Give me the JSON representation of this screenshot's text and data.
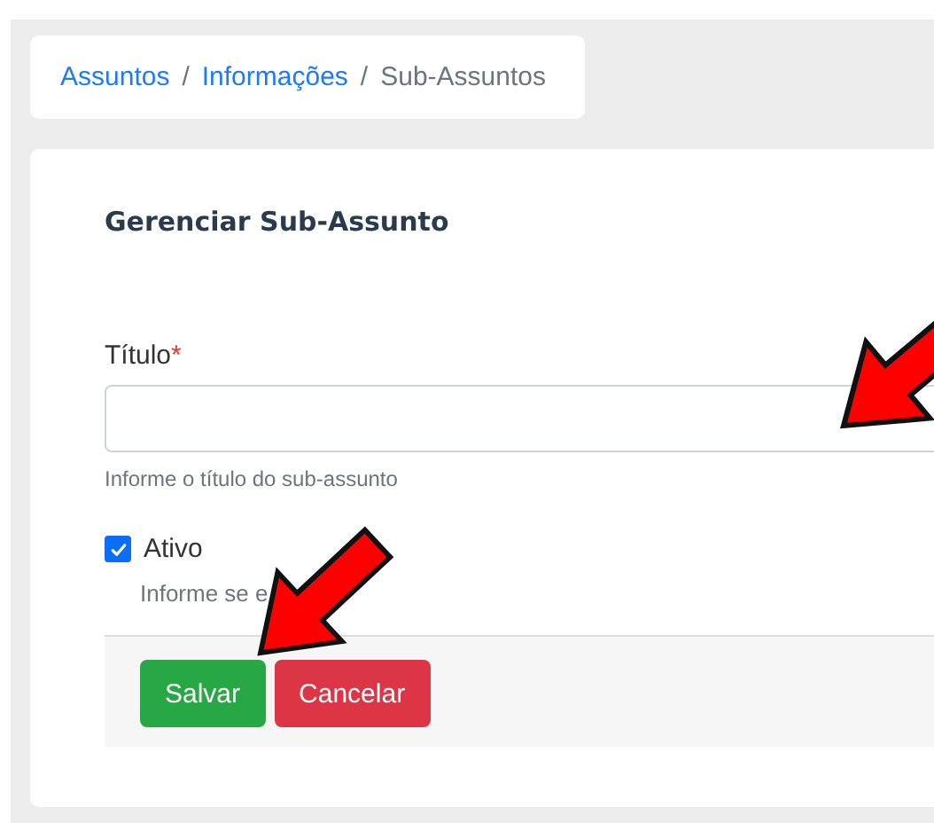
{
  "breadcrumb": [
    {
      "label": "Assuntos",
      "kind": "link"
    },
    {
      "label": "Informações",
      "kind": "link"
    },
    {
      "label": "Sub-Assuntos",
      "kind": "current"
    }
  ],
  "breadcrumb_separator": "/",
  "form": {
    "title": "Gerenciar Sub-Assunto",
    "title_field": {
      "label": "Título",
      "required_mark": "*",
      "help": "Informe o título do sub-assunto"
    },
    "active_field": {
      "label": "Ativo",
      "checked": true,
      "help": "Informe se e"
    },
    "buttons": [
      {
        "label": "Salvar",
        "kind": "success"
      },
      {
        "label": "Cancelar",
        "kind": "danger"
      }
    ]
  },
  "annotations": [
    {
      "kind": "arrow"
    },
    {
      "kind": "arrow"
    }
  ]
}
